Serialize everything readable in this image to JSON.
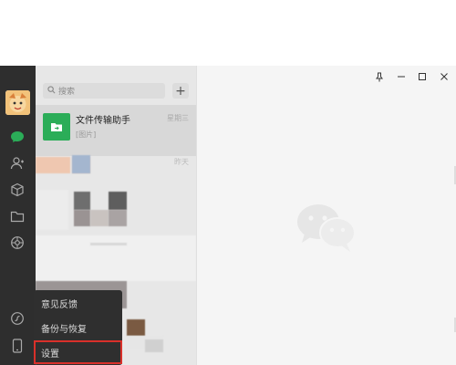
{
  "colors": {
    "rail": "#2e2e2e",
    "accent_green": "#2bad58",
    "highlight_red": "#d9302a"
  },
  "search": {
    "placeholder": "搜索"
  },
  "actions": {
    "add": "+"
  },
  "chats": [
    {
      "title": "文件传输助手",
      "time": "星期三",
      "preview": "[图片]",
      "icon": "folder-icon"
    },
    {
      "time": "昨天"
    }
  ],
  "rail_icons": [
    "chat-icon",
    "contacts-icon",
    "cube-icon",
    "folder-icon",
    "aperture-icon",
    "mini-program-icon",
    "phone-icon"
  ],
  "menu": {
    "items": [
      "意见反馈",
      "备份与恢复",
      "设置"
    ]
  },
  "window_controls": [
    "pin-icon",
    "minimize-icon",
    "maximize-icon",
    "close-icon"
  ]
}
